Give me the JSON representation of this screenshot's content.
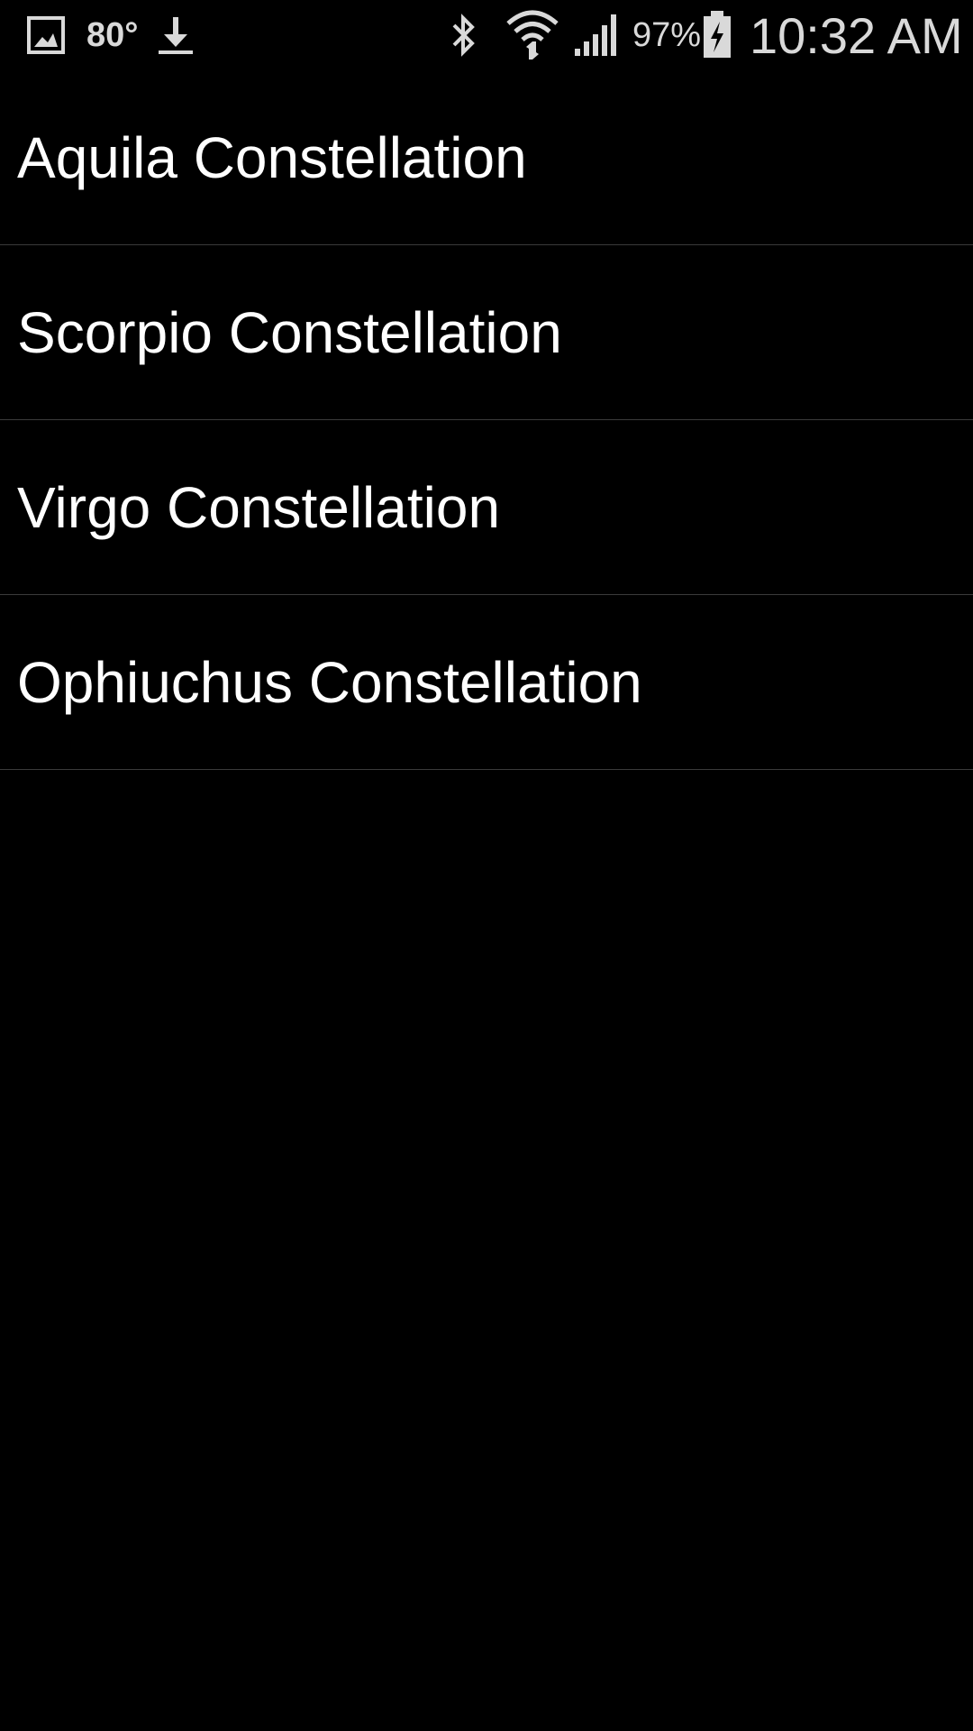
{
  "status_bar": {
    "notification_icons": [
      "gallery-icon",
      "download-icon"
    ],
    "temperature": "80°",
    "system_icons": [
      "bluetooth-icon",
      "wifi-icon",
      "signal-icon",
      "battery-charging-icon"
    ],
    "battery_percent": "97%",
    "time": "10:32 AM"
  },
  "list": {
    "items": [
      {
        "label": "Aquila Constellation"
      },
      {
        "label": "Scorpio Constellation"
      },
      {
        "label": "Virgo Constellation"
      },
      {
        "label": "Ophiuchus Constellation"
      }
    ]
  },
  "colors": {
    "background": "#000000",
    "text": "#ffffff",
    "status_text": "#d9d9d9",
    "divider": "#3a3a3a"
  }
}
